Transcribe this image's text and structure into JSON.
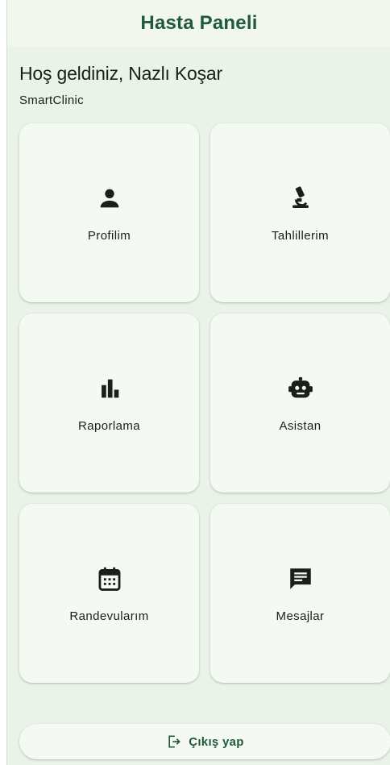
{
  "app_bar": {
    "title": "Hasta Paneli"
  },
  "header": {
    "welcome": "Hoş geldiniz, Nazlı Koşar",
    "clinic": "SmartClinic"
  },
  "tiles": [
    {
      "label": "Profilim",
      "icon": "person-icon"
    },
    {
      "label": "Tahlillerim",
      "icon": "microscope-icon"
    },
    {
      "label": "Raporlama",
      "icon": "bar-chart-icon"
    },
    {
      "label": "Asistan",
      "icon": "robot-icon"
    },
    {
      "label": "Randevularım",
      "icon": "calendar-icon"
    },
    {
      "label": "Mesajlar",
      "icon": "message-icon"
    }
  ],
  "logout": {
    "label": "Çıkış yap",
    "icon": "logout-icon"
  },
  "colors": {
    "primary": "#1f5a3a",
    "background": "#e9f3e7",
    "card": "#f4f9f4",
    "text": "#1b1f1c"
  }
}
